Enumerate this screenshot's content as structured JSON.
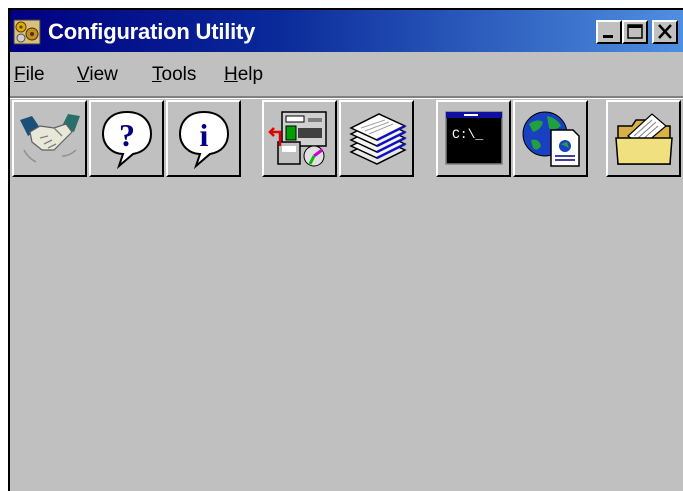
{
  "window": {
    "title": "Configuration Utility",
    "title_colors": {
      "from": "#000080",
      "to": "#4f8fe0"
    }
  },
  "title_controls": [
    {
      "name": "minimize",
      "icon": "minimize-icon"
    },
    {
      "name": "maximize",
      "icon": "maximize-icon"
    },
    {
      "name": "close",
      "icon": "close-icon"
    }
  ],
  "menu": {
    "items": [
      {
        "accel": "F",
        "rest": "ile"
      },
      {
        "accel": "V",
        "rest": "iew"
      },
      {
        "accel": "T",
        "rest": "ools"
      },
      {
        "accel": "H",
        "rest": "elp"
      }
    ]
  },
  "toolbar": {
    "buttons": [
      {
        "icon": "handshake-icon"
      },
      {
        "icon": "help-question-icon"
      },
      {
        "icon": "info-icon"
      },
      {
        "icon": "backup-restore-icon"
      },
      {
        "icon": "stacked-documents-icon"
      },
      {
        "icon": "command-prompt-icon",
        "prompt_text": "C:\\_"
      },
      {
        "icon": "web-globe-document-icon"
      },
      {
        "icon": "open-folder-icon"
      }
    ]
  }
}
